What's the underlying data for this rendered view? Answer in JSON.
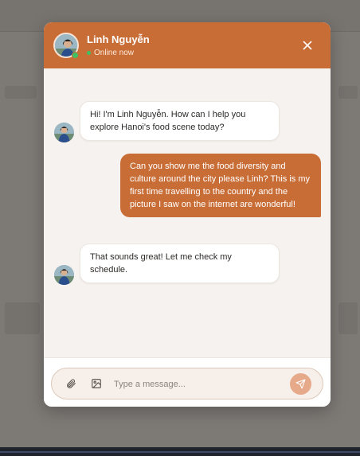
{
  "chat": {
    "agent_name": "Linh Nguyễn",
    "status": "Online now",
    "close_icon": "close-icon"
  },
  "messages": [
    {
      "sender": "agent",
      "text": "Hi! I'm Linh Nguyễn. How can I help you explore Hanoi's food scene today?"
    },
    {
      "sender": "user",
      "text": "Can you show me the food diversity and culture around the city please Linh? This is my first time travelling to the country and the picture I saw on the internet are wonderful!"
    },
    {
      "sender": "agent",
      "text": "That sounds great! Let me check my schedule."
    }
  ],
  "composer": {
    "placeholder": "Type a message...",
    "value": "",
    "attach_icon": "paperclip-icon",
    "image_icon": "image-icon",
    "send_icon": "send-icon"
  },
  "colors": {
    "accent": "#c96d37",
    "online": "#3fbf62",
    "panel_bg": "#f6f2ef",
    "send_button": "#e6a98a"
  }
}
